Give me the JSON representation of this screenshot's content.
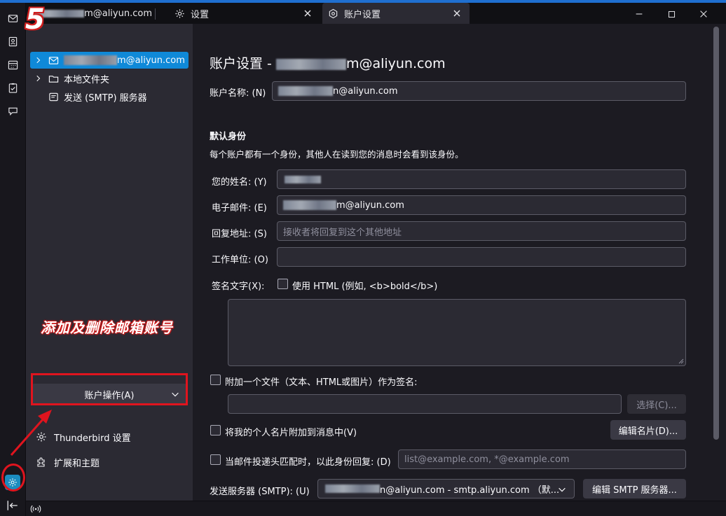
{
  "step_number": "5",
  "annotation_text": "添加及删除邮箱账号",
  "tabs": [
    {
      "label_suffix": "m@aliyun.com",
      "icon": "envelope-icon"
    },
    {
      "label": "设置",
      "icon": "gear-icon"
    },
    {
      "label": "账户设置",
      "icon": "account-settings-icon"
    }
  ],
  "window_controls": [
    "minimize-icon",
    "maximize-icon",
    "close-icon"
  ],
  "folder_tree": [
    {
      "label_suffix": "m@aliyun.com",
      "icon": "account-icon",
      "selected": true
    },
    {
      "label": "本地文件夹",
      "icon": "folder-icon"
    },
    {
      "label": "发送 (SMTP) 服务器",
      "icon": "server-icon"
    }
  ],
  "account_actions": {
    "label": "账户操作(A)"
  },
  "pane_links": [
    {
      "label": "Thunderbird 设置",
      "icon": "gear-icon"
    },
    {
      "label": "扩展和主题",
      "icon": "puzzle-icon"
    }
  ],
  "content": {
    "title_prefix": "账户设置 - ",
    "title_suffix": "m@aliyun.com",
    "account_name_label": "账户名称: (N)",
    "account_name_suffix": "n@aliyun.com",
    "identity_heading": "默认身份",
    "identity_desc": "每个账户都有一个身份，其他人在读到您的消息时会看到该身份。",
    "your_name_label": "您的姓名: (Y)",
    "email_label": "电子邮件: (E)",
    "email_suffix": "m@aliyun.com",
    "reply_to_label": "回复地址: (S)",
    "reply_to_placeholder": "接收者将回复到这个其他地址",
    "organization_label": "工作单位: (O)",
    "signature_label": "签名文字(X):",
    "use_html_label": "使用 HTML (例如, <b>bold</b>)",
    "attach_file_label": "附加一个文件（文本、HTML或图片）作为签名:",
    "choose_button": "选择(C)...",
    "attach_vcard_label": "将我的个人名片附加到消息中(V)",
    "edit_card_button": "编辑名片(D)...",
    "reply_match_label": "当邮件投递头匹配时，以此身份回复: (D)",
    "reply_match_placeholder": "list@example.com, *@example.com",
    "smtp_label": "发送服务器 (SMTP): (U)",
    "smtp_value_suffix": "n@aliyun.com - smtp.aliyun.com （默...",
    "edit_smtp_button": "编辑 SMTP 服务器..."
  },
  "colors": {
    "accent": "#0f89d8",
    "annotation_red": "#e0141e",
    "background": "#1c1b22",
    "panel": "#2b2a33"
  }
}
